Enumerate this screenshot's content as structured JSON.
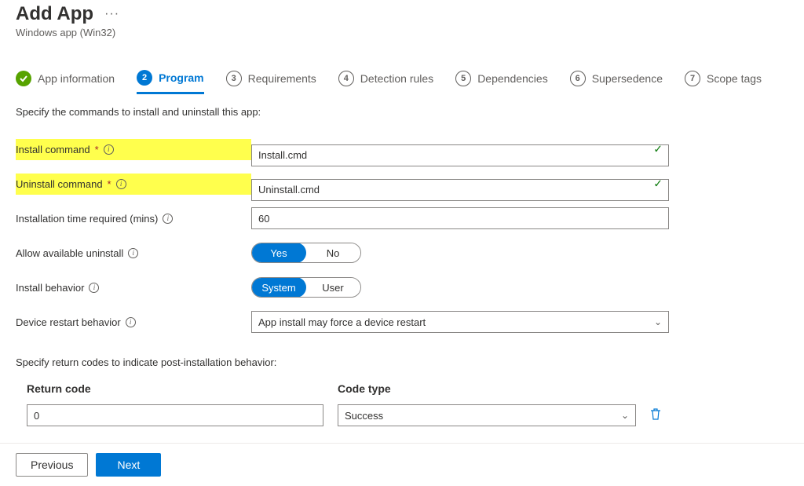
{
  "header": {
    "title": "Add App",
    "subtitle": "Windows app (Win32)"
  },
  "wizard": [
    {
      "num": "✓",
      "label": "App information",
      "state": "done"
    },
    {
      "num": "2",
      "label": "Program",
      "state": "active"
    },
    {
      "num": "3",
      "label": "Requirements",
      "state": "pending"
    },
    {
      "num": "4",
      "label": "Detection rules",
      "state": "pending"
    },
    {
      "num": "5",
      "label": "Dependencies",
      "state": "pending"
    },
    {
      "num": "6",
      "label": "Supersedence",
      "state": "pending"
    },
    {
      "num": "7",
      "label": "Scope tags",
      "state": "pending"
    }
  ],
  "intro": "Specify the commands to install and uninstall this app:",
  "fields": {
    "install_cmd": {
      "label": "Install command",
      "value": "Install.cmd",
      "required": true
    },
    "uninstall_cmd": {
      "label": "Uninstall command",
      "value": "Uninstall.cmd",
      "required": true
    },
    "install_time": {
      "label": "Installation time required (mins)",
      "value": "60"
    },
    "allow_uninstall": {
      "label": "Allow available uninstall",
      "yes": "Yes",
      "no": "No",
      "value": "Yes"
    },
    "install_behavior": {
      "label": "Install behavior",
      "opt1": "System",
      "opt2": "User",
      "value": "System"
    },
    "restart_behavior": {
      "label": "Device restart behavior",
      "value": "App install may force a device restart"
    }
  },
  "return_codes": {
    "intro": "Specify return codes to indicate post-installation behavior:",
    "header_code": "Return code",
    "header_type": "Code type",
    "rows": [
      {
        "code": "0",
        "type": "Success"
      }
    ]
  },
  "footer": {
    "previous": "Previous",
    "next": "Next"
  }
}
